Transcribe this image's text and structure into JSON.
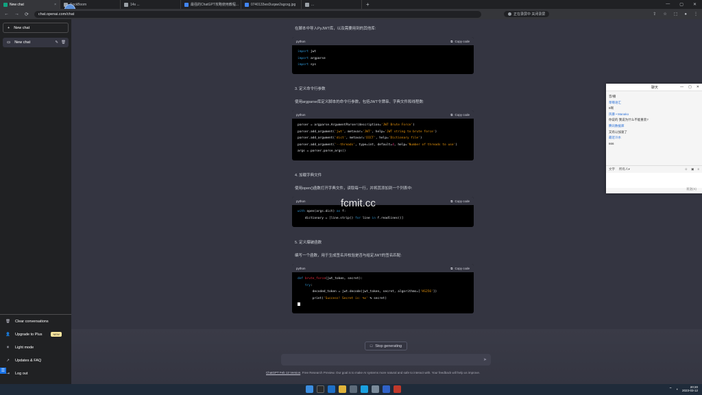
{
  "browser": {
    "tabs": [
      {
        "title": "New chat",
        "icon": "chatgpt-icon"
      },
      {
        "title": "SockBoom",
        "icon": "web-icon"
      },
      {
        "title": "14s ...",
        "icon": "web-icon"
      },
      {
        "title": "最强的ChatGPT攻略使用教程...",
        "icon": "web-icon"
      },
      {
        "title": "0740133wsDuqaw2agcsg.jpg",
        "icon": "web-icon"
      },
      {
        "title": "...",
        "icon": "web-icon"
      }
    ],
    "url": "chat.openai.com/chat",
    "avatar_text": "ideo",
    "mic_status": "正在录屏中 关闭录屏"
  },
  "sidebar": {
    "new_chat": "New chat",
    "chats": [
      {
        "title": "New chat"
      }
    ],
    "bottom": [
      {
        "label": "Clear conversations",
        "icon": "trash-icon"
      },
      {
        "label": "Upgrade to Plus",
        "icon": "user-icon",
        "badge": "NEW"
      },
      {
        "label": "Light mode",
        "icon": "sun-icon"
      },
      {
        "label": "Updates & FAQ",
        "icon": "external-link-icon"
      },
      {
        "label": "Log out",
        "icon": "logout-icon"
      }
    ]
  },
  "content": {
    "p1": "在脚本中导入PyJWT库，以及需要用到的其他库:",
    "code1": {
      "lang": "python",
      "copy": "Copy code"
    },
    "h2": "3. 定义命令行参数",
    "p2": "使用argparse库定义脚本的命令行参数，包括JWT令牌串、字典文件和线程数:",
    "code2": {
      "lang": "python",
      "copy": "Copy code"
    },
    "h3": "4. 加载字典文件",
    "p3": "使用open()函数打开字典文件，读取每一行，并将其添加到一个列表中:",
    "code3": {
      "lang": "python",
      "copy": "Copy code"
    },
    "h4": "5. 定义爆破函数",
    "p4": "编写一个函数，用于生成签名并校验是否与给定JWT的签名匹配:",
    "code4": {
      "lang": "python",
      "copy": "Copy code"
    }
  },
  "watermark": "fcmit.cc",
  "composer": {
    "stop": "Stop generating",
    "footer_link": "ChatGPT Feb 13 Version",
    "footer_text": ". Free Research Preview. Our goal is to make AI systems more natural and safe to interact with. Your feedback will help us improve."
  },
  "qq": {
    "title": "聊天",
    "messages": [
      {
        "text": "音/播",
        "style": "plain"
      },
      {
        "text": "草莓语汇",
        "style": "name"
      },
      {
        "text": "6啊",
        "style": "plain"
      },
      {
        "text": "风暴 • Manako",
        "style": "name"
      },
      {
        "text": "你说的 我说为什么不能重装?",
        "style": "plain"
      },
      {
        "text": "腾讯数据库",
        "style": "name"
      },
      {
        "text": "又有以加速了",
        "style": "plain"
      },
      {
        "text": "最近冷水",
        "style": "name"
      },
      {
        "text": "666",
        "style": "plain"
      }
    ],
    "toolbar_label": "文字",
    "toolbar_dropdown": "所有人▾",
    "send": "发送(S)"
  },
  "taskbar": {
    "time": "20:20",
    "date": "2023-03-12"
  }
}
